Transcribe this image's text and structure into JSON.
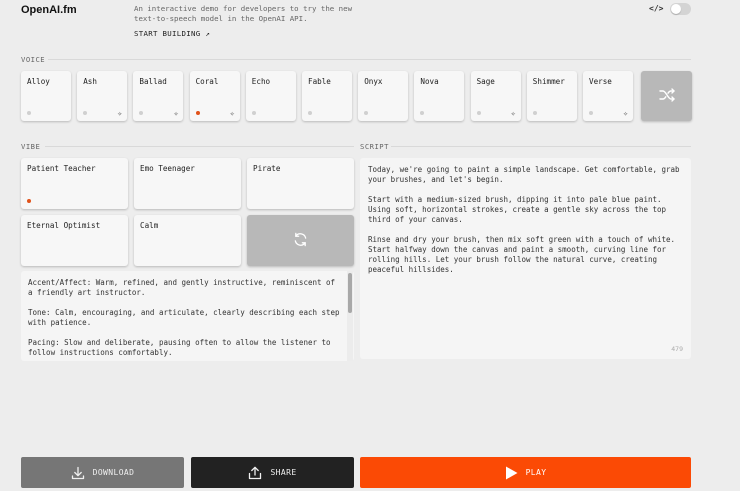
{
  "header": {
    "logo": "OpenAI.fm",
    "tagline": "An interactive demo for developers to try the new text-to-speech model in the OpenAI API.",
    "start_building": "START BUILDING ↗",
    "code_toggle_icon": "</>"
  },
  "voice": {
    "label": "VOICE",
    "items": [
      {
        "name": "Alloy",
        "selected": false,
        "spark": false
      },
      {
        "name": "Ash",
        "selected": false,
        "spark": true
      },
      {
        "name": "Ballad",
        "selected": false,
        "spark": true
      },
      {
        "name": "Coral",
        "selected": true,
        "spark": true
      },
      {
        "name": "Echo",
        "selected": false,
        "spark": false
      },
      {
        "name": "Fable",
        "selected": false,
        "spark": false
      },
      {
        "name": "Onyx",
        "selected": false,
        "spark": false
      },
      {
        "name": "Nova",
        "selected": false,
        "spark": false
      },
      {
        "name": "Sage",
        "selected": false,
        "spark": true
      },
      {
        "name": "Shimmer",
        "selected": false,
        "spark": false
      },
      {
        "name": "Verse",
        "selected": false,
        "spark": true
      }
    ],
    "shuffle_icon": "shuffle-icon"
  },
  "vibe": {
    "label": "VIBE",
    "items": [
      {
        "name": "Patient Teacher",
        "selected": true
      },
      {
        "name": "Emo Teenager",
        "selected": false
      },
      {
        "name": "Pirate",
        "selected": false
      },
      {
        "name": "Eternal Optimist",
        "selected": false
      },
      {
        "name": "Calm",
        "selected": false
      }
    ],
    "refresh_icon": "refresh-icon",
    "description": [
      "Accent/Affect: Warm, refined, and gently instructive, reminiscent of a friendly art instructor.",
      "Tone: Calm, encouraging, and articulate, clearly describing each step with patience.",
      "Pacing: Slow and deliberate, pausing often to allow the listener to follow instructions comfortably."
    ]
  },
  "script": {
    "label": "SCRIPT",
    "paragraphs": [
      "Today, we're going to paint a simple landscape. Get comfortable, grab your brushes, and let's begin.",
      "Start with a medium-sized brush, dipping it into pale blue paint. Using soft, horizontal strokes, create a gentle sky across the top third of your canvas.",
      "Rinse and dry your brush, then mix soft green with a touch of white. Start halfway down the canvas and paint a smooth, curving line for rolling hills. Let your brush follow the natural curve, creating peaceful hillsides."
    ],
    "char_count": "479"
  },
  "actions": {
    "download": "DOWNLOAD",
    "share": "SHARE",
    "play": "PLAY"
  },
  "colors": {
    "accent": "#fb4a05",
    "selected_dot": "#e0521a"
  }
}
